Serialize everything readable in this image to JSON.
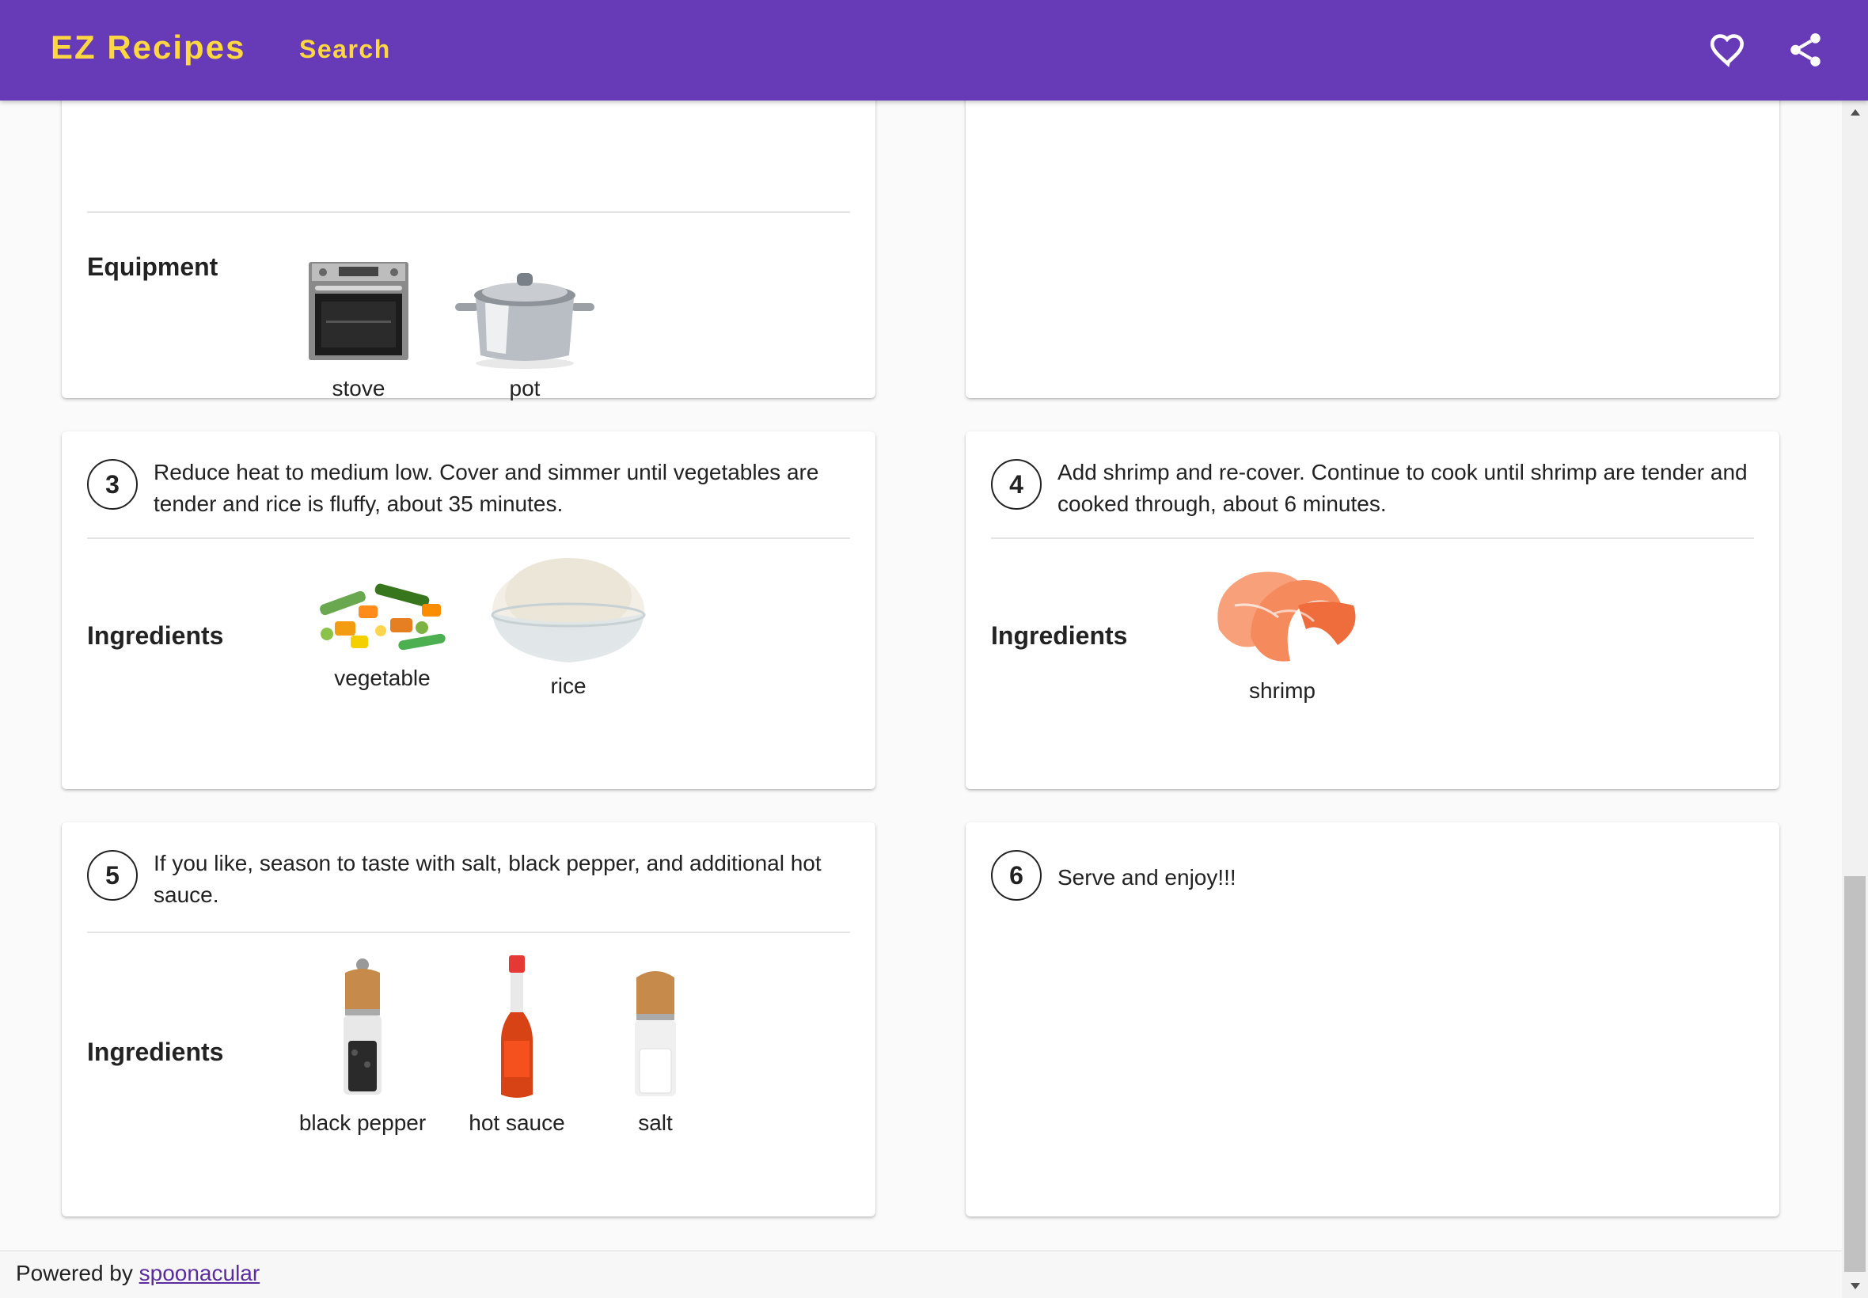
{
  "header": {
    "brand": "EZ Recipes",
    "nav_search": "Search",
    "icons": [
      "heart-icon",
      "share-icon"
    ],
    "colors": {
      "bar": "#673ab7",
      "accent": "#ffd740"
    }
  },
  "steps": [
    {
      "equipment_label": "Equipment",
      "equipment": [
        {
          "name": "stove",
          "icon": "oven"
        },
        {
          "name": "pot",
          "icon": "pot"
        }
      ]
    },
    {
      "number": "3",
      "text": "Reduce heat to medium low. Cover and simmer until vegetables are tender and rice is fluffy, about 35 minutes.",
      "ingredients_label": "Ingredients",
      "ingredients": [
        {
          "name": "vegetable",
          "icon": "mixed-vegetables"
        },
        {
          "name": "rice",
          "icon": "rice-bowl"
        }
      ]
    },
    {
      "number": "4",
      "text": "Add shrimp and re-cover. Continue to cook until shrimp are tender and cooked through, about 6 minutes.",
      "ingredients_label": "Ingredients",
      "ingredients": [
        {
          "name": "shrimp",
          "icon": "shrimp"
        }
      ]
    },
    {
      "number": "5",
      "text": "If you like, season to taste with salt, black pepper, and additional hot sauce.",
      "ingredients_label": "Ingredients",
      "ingredients": [
        {
          "name": "black pepper",
          "icon": "pepper-grinder"
        },
        {
          "name": "hot sauce",
          "icon": "hot-sauce-bottle"
        },
        {
          "name": "salt",
          "icon": "salt-grinder"
        }
      ]
    },
    {
      "number": "6",
      "text": "Serve and enjoy!!!"
    }
  ],
  "footer": {
    "prefix": "Powered by ",
    "link": "spoonacular"
  }
}
